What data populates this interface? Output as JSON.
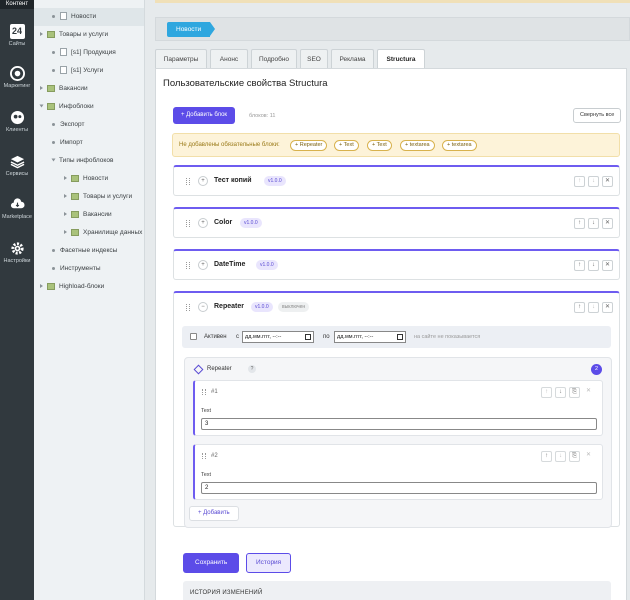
{
  "rail": {
    "top_label": "Контент",
    "items": [
      {
        "label": "Сайты",
        "icon": "calendar-icon",
        "glyph": "24"
      },
      {
        "label": "Маркетинг",
        "icon": "target-icon"
      },
      {
        "label": "Клиенты",
        "icon": "users-icon"
      },
      {
        "label": "Сервисы",
        "icon": "layers-icon"
      },
      {
        "label": "Marketplace",
        "icon": "cloud-download-icon"
      },
      {
        "label": "Настройки",
        "icon": "gear-icon"
      }
    ]
  },
  "tree": {
    "items": [
      {
        "label": "Новости"
      },
      {
        "label": "Товары и услуги"
      },
      {
        "label": "[s1] Продукция"
      },
      {
        "label": "[s1] Услуги"
      },
      {
        "label": "Вакансии"
      },
      {
        "label": "Инфоблоки"
      },
      {
        "label": "Экспорт"
      },
      {
        "label": "Импорт"
      },
      {
        "label": "Типы инфоблоков"
      },
      {
        "label": "Новости"
      },
      {
        "label": "Товары и услуги"
      },
      {
        "label": "Вакансии"
      },
      {
        "label": "Хранилище данных"
      },
      {
        "label": "Фасетные индексы"
      },
      {
        "label": "Инструменты"
      },
      {
        "label": "Highload-блоки"
      }
    ]
  },
  "breadcrumb": {
    "label": "Новости"
  },
  "tabs": [
    "Параметры",
    "Анонс",
    "Подробно",
    "SEO",
    "Реклама",
    "Structura"
  ],
  "page": {
    "title": "Пользовательские свойства Structura",
    "add_block": "+ Добавить блок",
    "blocks_count": "блоков: 11",
    "collapse_all": "Свернуть все"
  },
  "warning": {
    "text": "Не добавлены обязательные блоки:",
    "chips": [
      "+ Repeater",
      "+ Text",
      "+ Text",
      "+ textarea",
      "+ textarea"
    ]
  },
  "blocks": [
    {
      "name": "Тест копий",
      "version": "v1.0.0"
    },
    {
      "name": "Color",
      "version": "v1.0.0"
    },
    {
      "name": "DateTime",
      "version": "v1.0.0"
    }
  ],
  "repeater_block": {
    "name": "Repeater",
    "version": "v1.0.0",
    "status": "выключен",
    "active_label": "Активен",
    "from_label": "с",
    "to_label": "по",
    "date_placeholder": "дд.мм.гггг, --:--",
    "hidden_note": "на сайте не показывается",
    "inner_title": "Repeater",
    "inner_help": "?",
    "item_count": "2",
    "items": [
      {
        "num": "#1",
        "field_label": "Text",
        "value": "3"
      },
      {
        "num": "#2",
        "field_label": "Text",
        "value": "2"
      }
    ],
    "add_item": "+ Добавить"
  },
  "footer": {
    "save": "Сохранить",
    "history": "История",
    "history_header": "ИСТОРИЯ ИЗМЕНЕНИЙ"
  },
  "controls": {
    "up": "↑",
    "down": "↓",
    "close": "✕",
    "copy": "⎘",
    "expand": "+",
    "collapse": "−"
  }
}
